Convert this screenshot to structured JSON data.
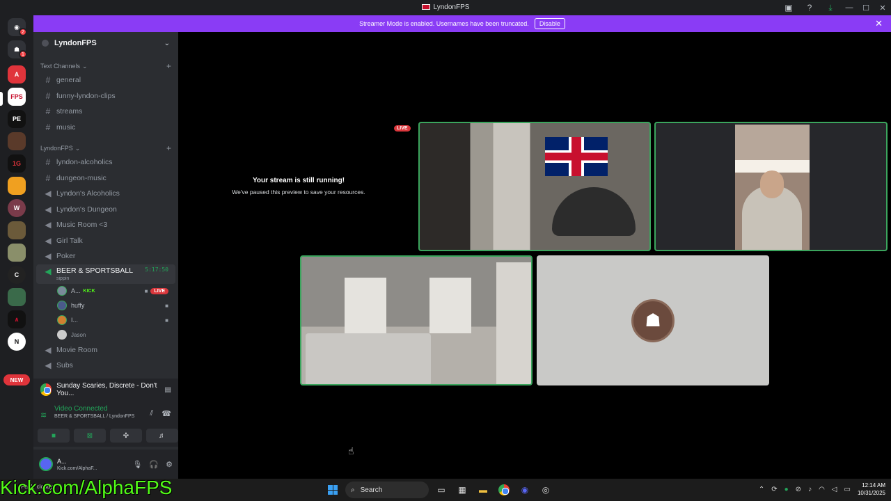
{
  "window": {
    "title": "LyndonFPS"
  },
  "banner": {
    "text": "Streamer Mode is enabled. Usernames have been truncated.",
    "button": "Disable"
  },
  "rail": {
    "badges": [
      "2",
      "1"
    ],
    "new_label": "NEW"
  },
  "guild": {
    "name": "LyndonFPS"
  },
  "categories": [
    {
      "name": "Text Channels",
      "channels": [
        "general",
        "funny-lyndon-clips",
        "streams",
        "music"
      ]
    },
    {
      "name": "LyndonFPS",
      "text_channels": [
        "lyndon-alcoholics",
        "dungeon-music"
      ],
      "voice_channels": [
        "Lyndon's Alcoholics",
        "Lyndon's Dungeon",
        "Music Room <3",
        "Girl Talk",
        "Poker"
      ]
    }
  ],
  "active_voice": {
    "name": "BEER & SPORTSBALL",
    "status": "sippin",
    "timer": "5:17:50",
    "users": [
      {
        "name": "A...",
        "tag": "KICK",
        "live": "LIVE"
      },
      {
        "name": "huffy"
      },
      {
        "name": "I..."
      },
      {
        "name": "Jason"
      }
    ]
  },
  "more_voice": [
    "Movie Room",
    "Subs"
  ],
  "activity": {
    "text": "Sunday Scaries, Discrete - Don't You..."
  },
  "voice_panel": {
    "status": "Video Connected",
    "sub": "BEER & SPORTSBALL / LyndonFPS"
  },
  "user": {
    "name": "A...",
    "status": "Kick.com/AlphaF..."
  },
  "stage": {
    "paused_title": "Your stream is still running!",
    "paused_sub": "We've paused this preview to save your resources.",
    "live_tag": "LIVE"
  },
  "overlay": "Kick.com/AlphaFPS",
  "taskbar": {
    "weather": "Partly cloudy",
    "search": "Search",
    "time": "12:14 AM",
    "date": "10/31/2025"
  },
  "colors": {
    "accent": "#8a3cf5",
    "green": "#23a55a",
    "live": "#da373c",
    "kick": "#53fc18"
  }
}
